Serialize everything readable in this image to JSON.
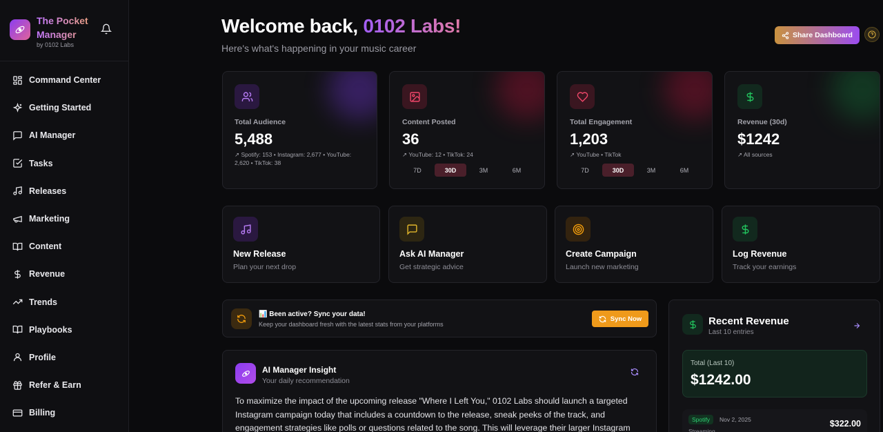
{
  "brand": {
    "title": "The Pocket Manager",
    "subtitle": "by 0102 Labs"
  },
  "sidebar": {
    "items": [
      {
        "label": "Command Center",
        "icon": "grid-icon"
      },
      {
        "label": "Getting Started",
        "icon": "sparkles-icon"
      },
      {
        "label": "AI Manager",
        "icon": "message-icon"
      },
      {
        "label": "Tasks",
        "icon": "checkbox-icon"
      },
      {
        "label": "Releases",
        "icon": "music-icon"
      },
      {
        "label": "Marketing",
        "icon": "megaphone-icon"
      },
      {
        "label": "Content",
        "icon": "book-open-icon"
      },
      {
        "label": "Revenue",
        "icon": "dollar-icon"
      },
      {
        "label": "Trends",
        "icon": "trending-up-icon"
      },
      {
        "label": "Playbooks",
        "icon": "book-icon"
      },
      {
        "label": "Profile",
        "icon": "user-icon"
      },
      {
        "label": "Refer & Earn",
        "icon": "gift-icon"
      },
      {
        "label": "Billing",
        "icon": "credit-card-icon"
      }
    ]
  },
  "header": {
    "welcome_prefix": "Welcome back, ",
    "welcome_name": "0102 Labs!",
    "subtitle": "Here's what's happening in your music career",
    "share_label": "Share Dashboard"
  },
  "stats": [
    {
      "label": "Total Audience",
      "value": "5,488",
      "detail": "Spotify: 153 • Instagram: 2,677 • YouTube: 2,620 • TikTok: 38",
      "color": "#a855f7"
    },
    {
      "label": "Content Posted",
      "value": "36",
      "detail": "YouTube: 12 • TikTok: 24",
      "ranges": [
        "7D",
        "30D",
        "3M",
        "6M"
      ],
      "active_range": "30D",
      "color": "#e0475f"
    },
    {
      "label": "Total Engagement",
      "value": "1,203",
      "detail": "YouTube • TikTok",
      "ranges": [
        "7D",
        "30D",
        "3M",
        "6M"
      ],
      "active_range": "30D",
      "color": "#f0476a"
    },
    {
      "label": "Revenue (30d)",
      "value": "$1242",
      "detail": "All sources",
      "color": "#22c55e"
    }
  ],
  "actions": [
    {
      "title": "New Release",
      "subtitle": "Plan your next drop",
      "color": "#a855f7"
    },
    {
      "title": "Ask AI Manager",
      "subtitle": "Get strategic advice",
      "color": "#eab308"
    },
    {
      "title": "Create Campaign",
      "subtitle": "Launch new marketing",
      "color": "#f59e0b"
    },
    {
      "title": "Log Revenue",
      "subtitle": "Track your earnings",
      "color": "#22c55e"
    }
  ],
  "sync": {
    "title": "📊 Been active? Sync your data!",
    "subtitle": "Keep your dashboard fresh with the latest stats from your platforms",
    "button": "Sync Now"
  },
  "insight": {
    "title": "AI Manager Insight",
    "subtitle": "Your daily recommendation",
    "body": "To maximize the impact of the upcoming release \"Where I Left You,\" 0102 Labs should launch a targeted Instagram campaign today that includes a countdown to the release, sneak peeks of the track, and engagement strategies like polls or questions related to the song. This will leverage their larger Instagram following to drive"
  },
  "revenue": {
    "title": "Recent Revenue",
    "subtitle": "Last 10 entries",
    "total_label": "Total (Last 10)",
    "total_value": "$1242.00",
    "entry": {
      "source": "Spotify",
      "date": "Nov 2, 2025",
      "amount": "$322.00",
      "type": "Streaming"
    }
  }
}
